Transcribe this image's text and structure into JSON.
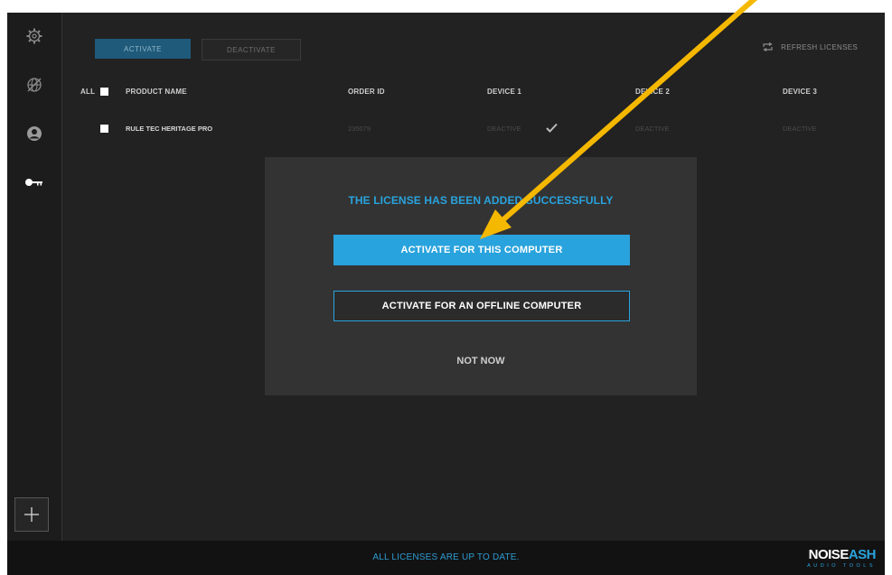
{
  "toolbar": {
    "activate_label": "ACTIVATE",
    "deactivate_label": "DEACTIVATE",
    "refresh_label": "REFRESH LICENSES"
  },
  "table": {
    "headers": {
      "all": "ALL",
      "product": "PRODUCT NAME",
      "order": "ORDER ID",
      "device1": "DEVICE 1",
      "device2": "DEVICE 2",
      "device3": "DEVICE 3"
    },
    "rows": [
      {
        "product": "RULE TEC HERITAGE PRO",
        "order_id": "235079",
        "device1": "DEACTIVE",
        "device2": "DEACTIVE",
        "device3": "DEACTIVE"
      }
    ]
  },
  "dialog": {
    "title": "THE LICENSE HAS BEEN ADDED SUCCESSFULLY",
    "primary": "ACTIVATE FOR THIS COMPUTER",
    "secondary": "ACTIVATE FOR AN OFFLINE COMPUTER",
    "dismiss": "NOT NOW"
  },
  "status": {
    "text": "ALL LICENSES ARE UP TO DATE."
  },
  "logo": {
    "main_a": "NOISE",
    "main_b": "ASH",
    "sub": "AUDIO TOOLS"
  },
  "sidebar": {
    "icons": [
      "gear-icon",
      "globe-icon",
      "user-icon",
      "key-icon"
    ]
  },
  "colors": {
    "accent": "#29a3dd",
    "arrow": "#f5b800",
    "background": "#222222"
  }
}
